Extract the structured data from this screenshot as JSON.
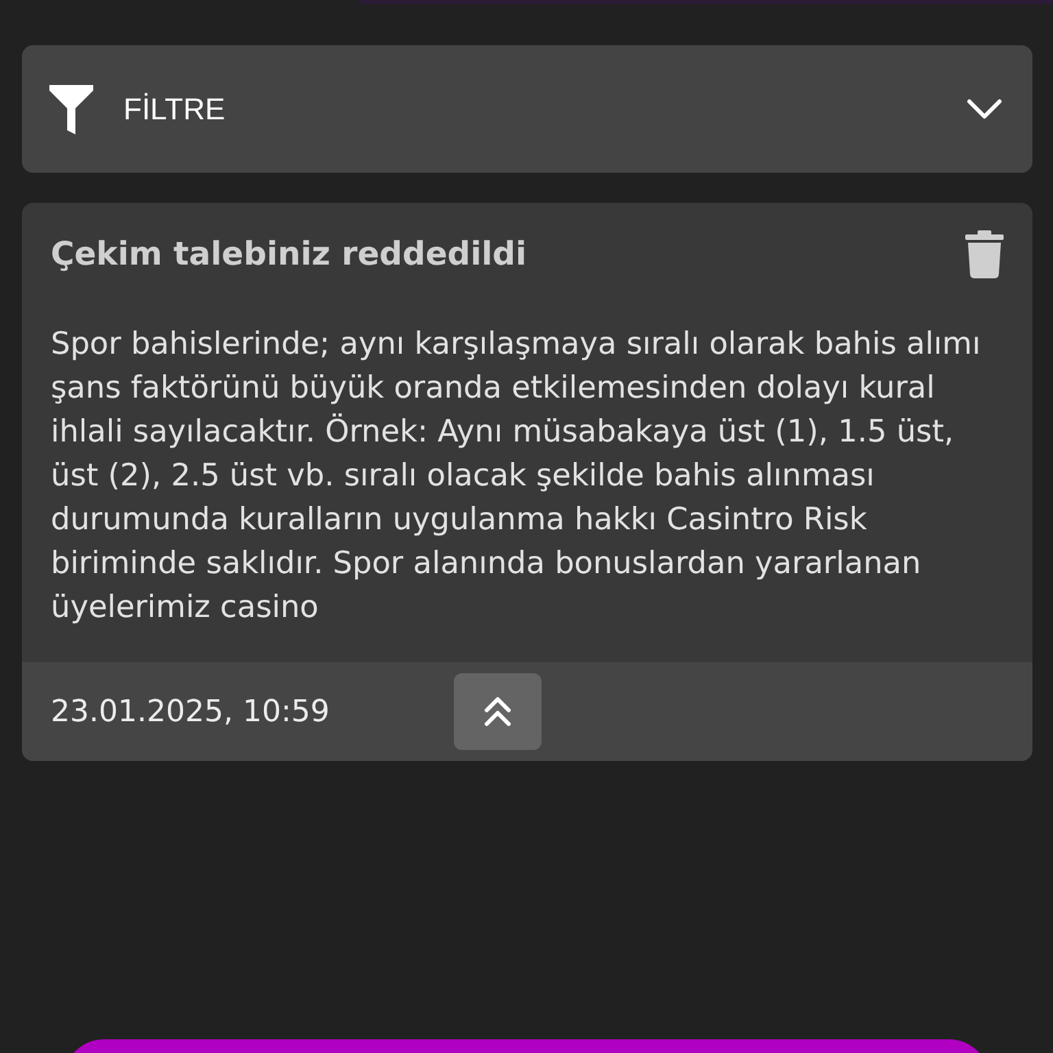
{
  "filter": {
    "label": "FİLTRE",
    "expanded": false
  },
  "notifications": [
    {
      "title": "Çekim talebiniz reddedildi",
      "body": "Spor bahislerinde; aynı karşılaşmaya sıralı olarak bahis alımı şans faktörünü büyük oranda etkilemesinden dolayı kural ihlali sayılacaktır. Örnek: Aynı müsabakaya üst (1), 1.5 üst, üst (2), 2.5 üst vb. sıralı olacak şekilde bahis alınması durumunda kuralların uygulanma hakkı Casintro Risk biriminde saklıdır. Spor alanında bonuslardan yararlanan üyelerimiz casino",
      "date": "23.01.2025, 10:59",
      "expanded": true
    }
  ]
}
